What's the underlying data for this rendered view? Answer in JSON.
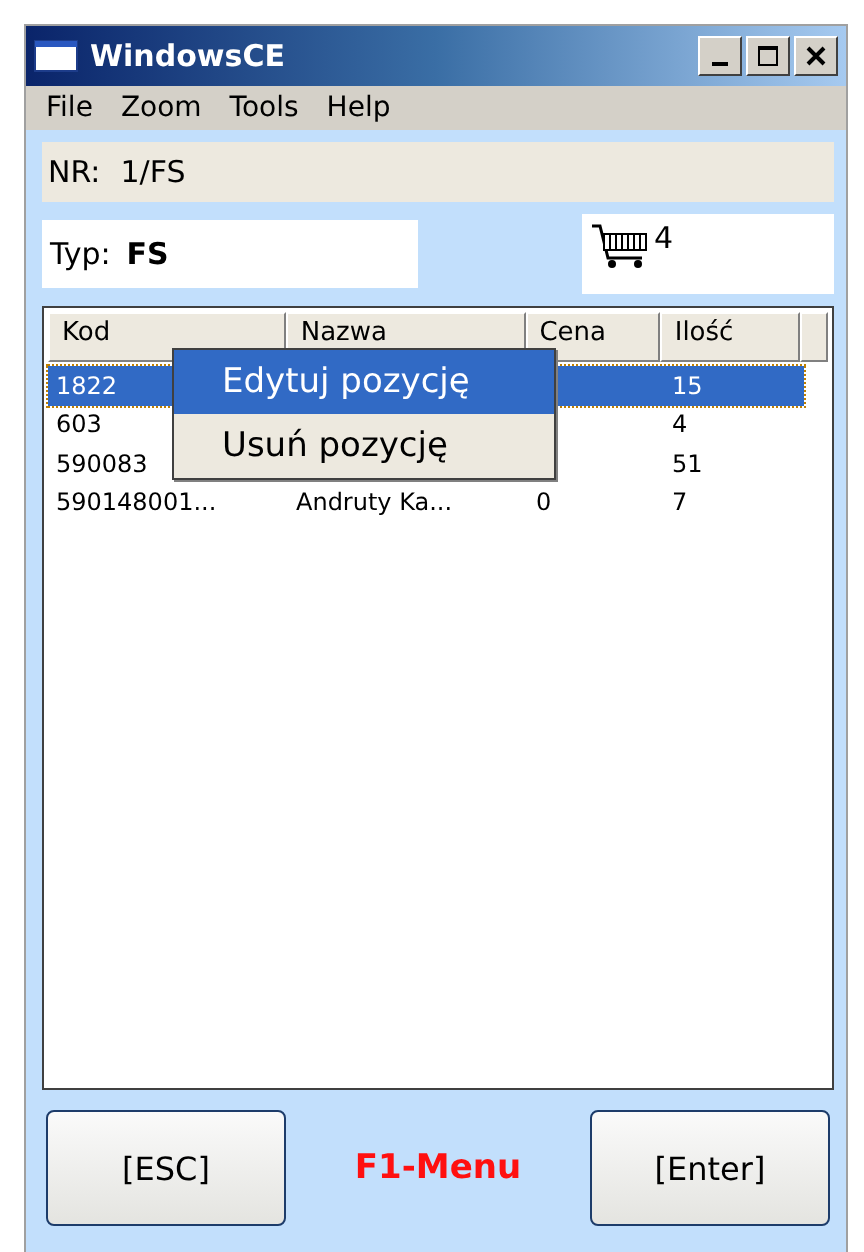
{
  "window": {
    "title": "WindowsCE"
  },
  "menu_bar": [
    "File",
    "Zoom",
    "Tools",
    "Help"
  ],
  "nr": {
    "label": "NR:",
    "value": "1/FS"
  },
  "typ": {
    "label": "Typ:",
    "value": "FS"
  },
  "cart": {
    "count": "4"
  },
  "table": {
    "columns": [
      "Kod",
      "Nazwa",
      "Cena",
      "Ilość"
    ],
    "rows": [
      {
        "cells": [
          "1822",
          "",
          "",
          "15"
        ],
        "selected": true
      },
      {
        "cells": [
          "603",
          "",
          "",
          "4"
        ],
        "selected": false
      },
      {
        "cells": [
          "590083",
          "",
          "",
          "51"
        ],
        "selected": false
      },
      {
        "cells": [
          "590148001...",
          "Andruty Ka...",
          "0",
          "7"
        ],
        "selected": false
      }
    ]
  },
  "context_menu": [
    {
      "label": "Edytuj pozycję",
      "selected": true
    },
    {
      "label": "Usuń pozycję",
      "selected": false
    }
  ],
  "buttons": {
    "left": "[ESC]",
    "hint": "F1-Menu",
    "right": "[Enter]"
  }
}
